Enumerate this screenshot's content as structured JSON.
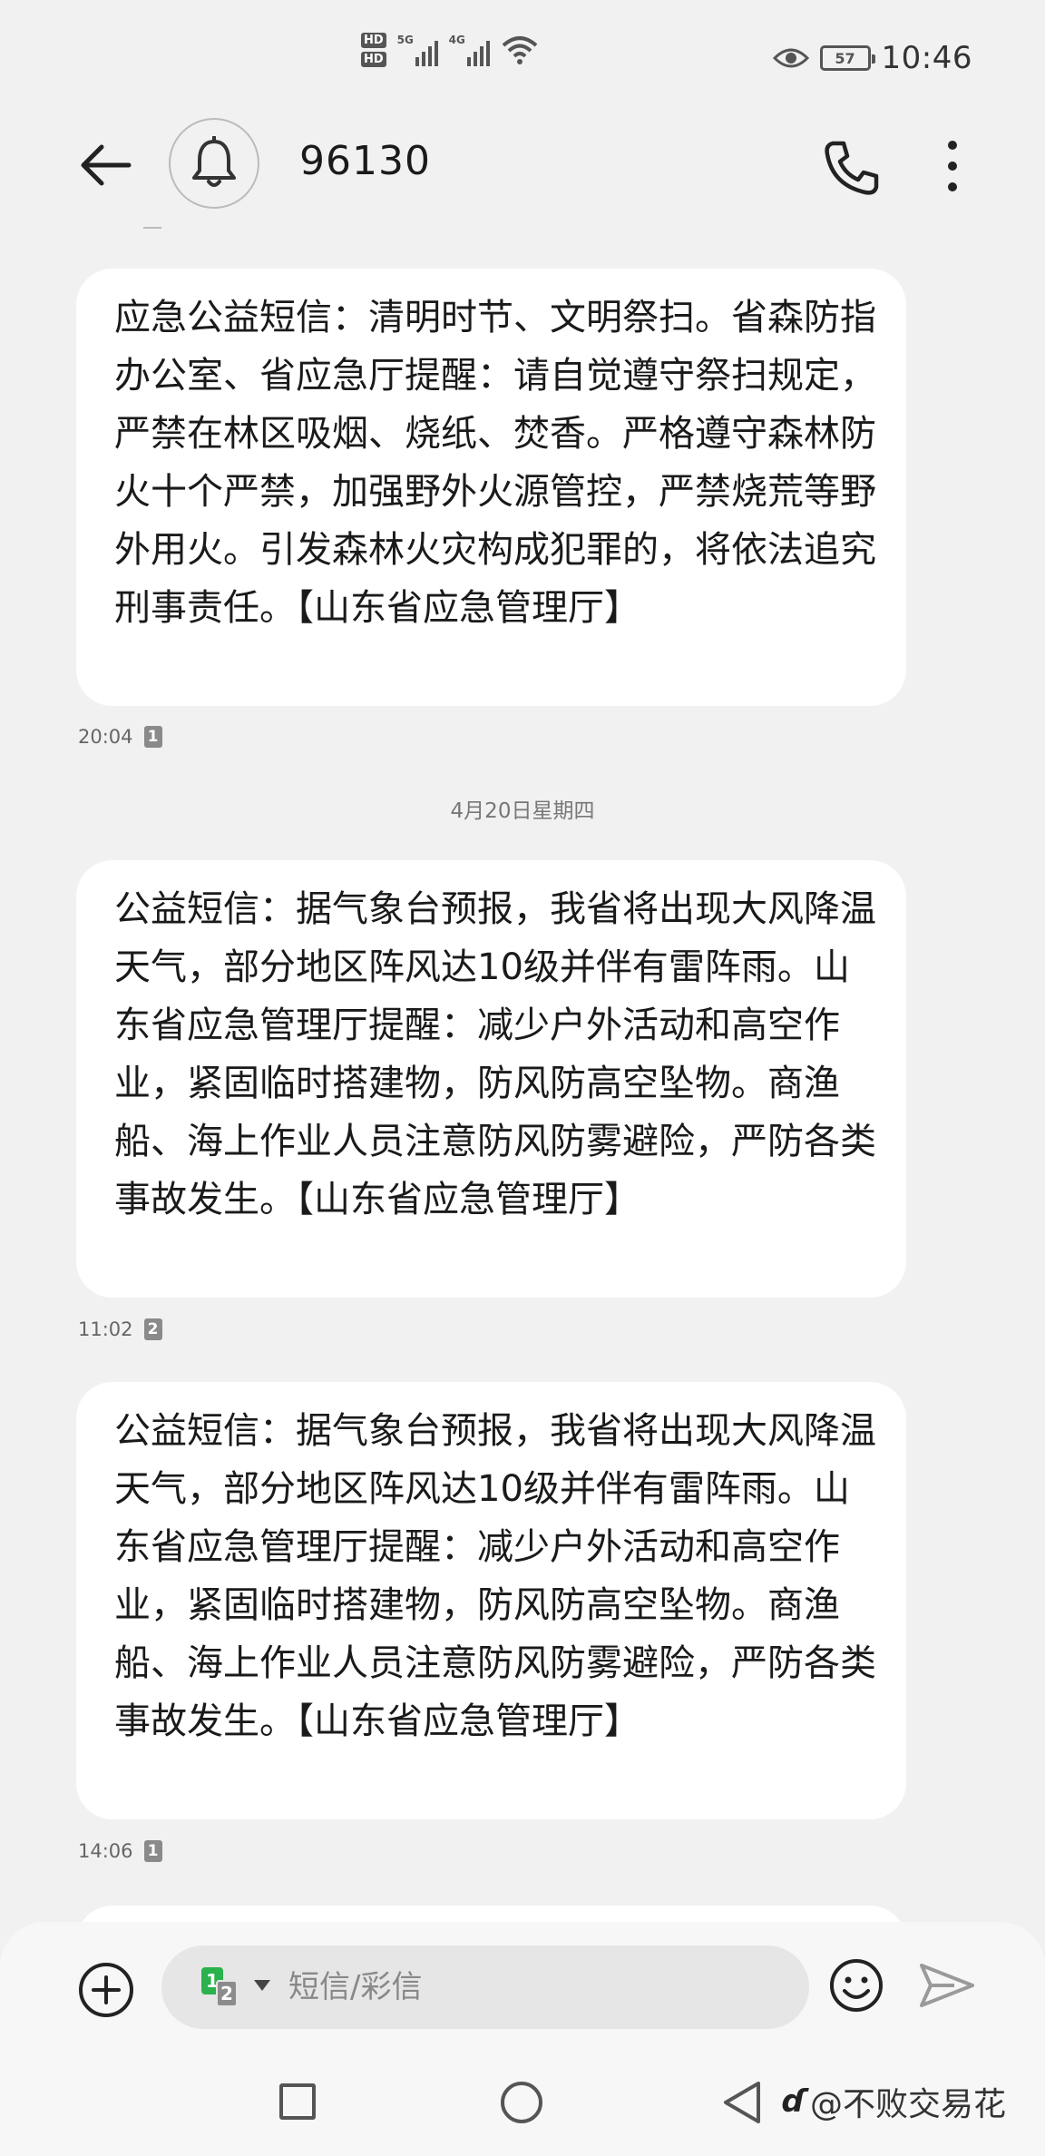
{
  "status_bar": {
    "hd1": "HD",
    "hd2": "HD",
    "sim1_tech": "5G",
    "sim2_tech": "4G",
    "battery": "57",
    "time": "10:46"
  },
  "header": {
    "contact": "96130"
  },
  "date_separator": "4月20日星期四",
  "messages": [
    {
      "text": "应急公益短信：清明时节、文明祭扫。省森防指办公室、省应急厅提醒：请自觉遵守祭扫规定，严禁在林区吸烟、烧纸、焚香。严格遵守森林防火十个严禁，加强野外火源管控，严禁烧荒等野外用火。引发森林火灾构成犯罪的，将依法追究刑事责任。【山东省应急管理厅】",
      "time": "20:04",
      "sim": "1"
    },
    {
      "text": "公益短信：据气象台预报，我省将出现大风降温天气，部分地区阵风达10级并伴有雷阵雨。山东省应急管理厅提醒：减少户外活动和高空作业，紧固临时搭建物，防风防高空坠物。商渔船、海上作业人员注意防风防雾避险，严防各类事故发生。【山东省应急管理厅】",
      "time": "11:02",
      "sim": "2"
    },
    {
      "text": "公益短信：据气象台预报，我省将出现大风降温天气，部分地区阵风达10级并伴有雷阵雨。山东省应急管理厅提醒：减少户外活动和高空作业，紧固临时搭建物，防风防高空坠物。商渔船、海上作业人员注意防风防雾避险，严防各类事故发生。【山东省应急管理厅】",
      "time": "14:06",
      "sim": "1"
    }
  ],
  "compose": {
    "placeholder": "短信/彩信",
    "sim_active": "1",
    "sim_other": "2"
  },
  "watermark": {
    "logo": "ɗ",
    "text": "@不败交易花"
  },
  "icons": {
    "back": "back-arrow-icon",
    "avatar": "bell-icon",
    "call": "phone-icon",
    "more": "more-vertical-icon",
    "add": "plus-circle-icon",
    "emoji": "smiley-icon",
    "send": "send-icon"
  },
  "colors": {
    "background": "#f1f1f1",
    "bubble": "#ffffff",
    "sim1_green": "#2bb24c"
  }
}
